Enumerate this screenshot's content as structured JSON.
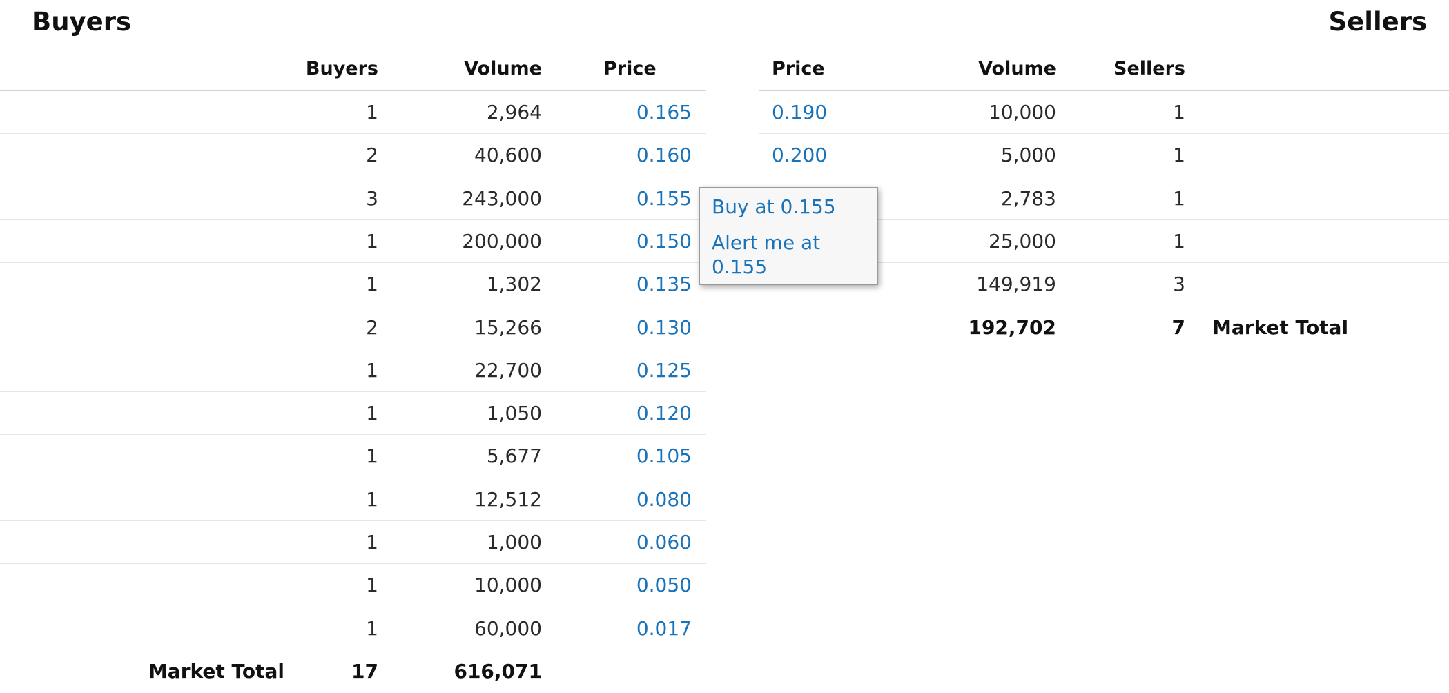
{
  "buyers": {
    "title": "Buyers",
    "columns": {
      "buyers": "Buyers",
      "volume": "Volume",
      "price": "Price"
    },
    "rows": [
      {
        "buyers": "1",
        "volume": "2,964",
        "price": "0.165"
      },
      {
        "buyers": "2",
        "volume": "40,600",
        "price": "0.160"
      },
      {
        "buyers": "3",
        "volume": "243,000",
        "price": "0.155"
      },
      {
        "buyers": "1",
        "volume": "200,000",
        "price": "0.150"
      },
      {
        "buyers": "1",
        "volume": "1,302",
        "price": "0.135"
      },
      {
        "buyers": "2",
        "volume": "15,266",
        "price": "0.130"
      },
      {
        "buyers": "1",
        "volume": "22,700",
        "price": "0.125"
      },
      {
        "buyers": "1",
        "volume": "1,050",
        "price": "0.120"
      },
      {
        "buyers": "1",
        "volume": "5,677",
        "price": "0.105"
      },
      {
        "buyers": "1",
        "volume": "12,512",
        "price": "0.080"
      },
      {
        "buyers": "1",
        "volume": "1,000",
        "price": "0.060"
      },
      {
        "buyers": "1",
        "volume": "10,000",
        "price": "0.050"
      },
      {
        "buyers": "1",
        "volume": "60,000",
        "price": "0.017"
      }
    ],
    "total": {
      "label": "Market Total",
      "buyers": "17",
      "volume": "616,071"
    }
  },
  "sellers": {
    "title": "Sellers",
    "columns": {
      "price": "Price",
      "volume": "Volume",
      "sellers": "Sellers"
    },
    "rows": [
      {
        "price": "0.190",
        "volume": "10,000",
        "sellers": "1"
      },
      {
        "price": "0.200",
        "volume": "5,000",
        "sellers": "1"
      },
      {
        "price": "",
        "volume": "2,783",
        "sellers": "1"
      },
      {
        "price": "",
        "volume": "25,000",
        "sellers": "1"
      },
      {
        "price": "",
        "volume": "149,919",
        "sellers": "3"
      }
    ],
    "total": {
      "label": "Market Total",
      "volume": "192,702",
      "sellers": "7"
    }
  },
  "popup": {
    "buy_label": "Buy at 0.155",
    "alert_label": "Alert me at 0.155"
  },
  "colors": {
    "link": "#1a73b8",
    "rule": "#e3e6ea"
  }
}
